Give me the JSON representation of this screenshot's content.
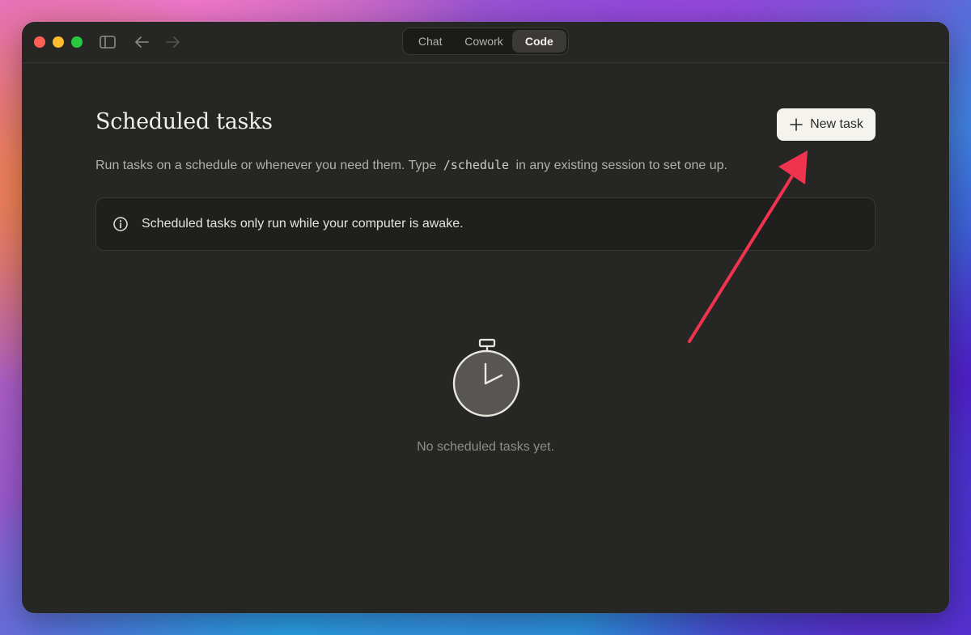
{
  "titlebar": {
    "modes": [
      {
        "label": "Chat",
        "active": false
      },
      {
        "label": "Cowork",
        "active": false
      },
      {
        "label": "Code",
        "active": true
      }
    ]
  },
  "page": {
    "title": "Scheduled tasks",
    "new_task_label": "New task",
    "subtitle_before": "Run tasks on a schedule or whenever you need them. Type",
    "subtitle_code": "/schedule",
    "subtitle_after": "in any existing session to set one up.",
    "notice": "Scheduled tasks only run while your computer is awake.",
    "empty_state": "No scheduled tasks yet."
  },
  "icons": {
    "sidebar_toggle": "sidebar-icon",
    "back": "arrow-left-icon",
    "forward": "arrow-right-icon",
    "plus": "plus-icon",
    "info": "info-icon",
    "empty": "stopwatch-icon"
  },
  "colors": {
    "window_bg": "#262624",
    "button_bg": "#f5f3ee",
    "annotation_arrow": "#f0334f"
  }
}
